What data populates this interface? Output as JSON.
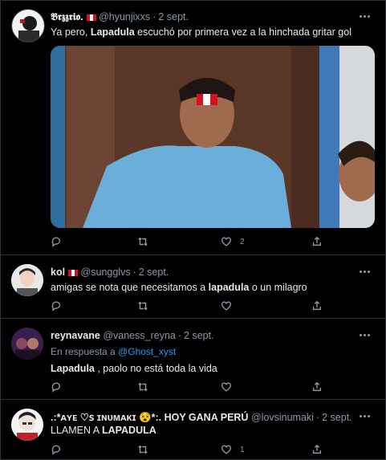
{
  "tweets": [
    {
      "name": "𝕭𝖗𝖟𝖟𝖗𝖎𝖔.",
      "handle": "@hyunjixxs",
      "date": "2 sept.",
      "text_pre": "Ya pero, ",
      "text_bold": "Lapadula",
      "text_post": " escuchó por primera vez a la hinchada gritar gol",
      "likes": "2"
    },
    {
      "name": "kol",
      "handle": "@sungglvs",
      "date": "2 sept.",
      "text_pre": "amigas se nota que necesitamos a ",
      "text_bold": "lapadula",
      "text_post": " o un milagro"
    },
    {
      "name": "reynavane",
      "handle": "@vaness_reyna",
      "date": "2 sept.",
      "reply_prefix": "En respuesta a ",
      "reply_handle": "@Ghost_xyst",
      "text_pre": "",
      "text_bold": "Lapadula",
      "text_post": " , paolo no está toda la vida"
    },
    {
      "name": ".:*ᴀʏᴇ ♡ꜱ ɪɴᴜᴍᴀᴋɪ 😵*:. HOY GANA PERÚ",
      "handle": "@lovsinumaki",
      "date": "2 sept.",
      "text_pre": "LLAMEN A ",
      "text_bold": "LAPADULA",
      "text_post": "",
      "likes": "1"
    }
  ],
  "icons": [
    "reply-icon",
    "retweet-icon",
    "like-icon",
    "share-icon",
    "more-icon",
    "peru-flag"
  ],
  "colors": {
    "background": "#000000",
    "border": "#2f3336",
    "muted": "#8b98a5",
    "link": "#1d9bf0",
    "text": "#e7e9ea"
  }
}
